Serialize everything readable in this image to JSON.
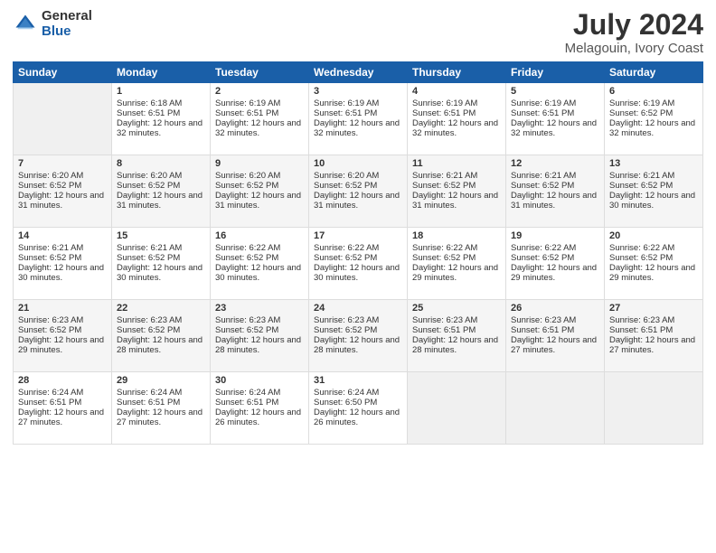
{
  "header": {
    "logo_general": "General",
    "logo_blue": "Blue",
    "month_title": "July 2024",
    "location": "Melagouin, Ivory Coast"
  },
  "days_of_week": [
    "Sunday",
    "Monday",
    "Tuesday",
    "Wednesday",
    "Thursday",
    "Friday",
    "Saturday"
  ],
  "weeks": [
    [
      {
        "day": "",
        "sunrise": "",
        "sunset": "",
        "daylight": ""
      },
      {
        "day": "1",
        "sunrise": "Sunrise: 6:18 AM",
        "sunset": "Sunset: 6:51 PM",
        "daylight": "Daylight: 12 hours and 32 minutes."
      },
      {
        "day": "2",
        "sunrise": "Sunrise: 6:19 AM",
        "sunset": "Sunset: 6:51 PM",
        "daylight": "Daylight: 12 hours and 32 minutes."
      },
      {
        "day": "3",
        "sunrise": "Sunrise: 6:19 AM",
        "sunset": "Sunset: 6:51 PM",
        "daylight": "Daylight: 12 hours and 32 minutes."
      },
      {
        "day": "4",
        "sunrise": "Sunrise: 6:19 AM",
        "sunset": "Sunset: 6:51 PM",
        "daylight": "Daylight: 12 hours and 32 minutes."
      },
      {
        "day": "5",
        "sunrise": "Sunrise: 6:19 AM",
        "sunset": "Sunset: 6:51 PM",
        "daylight": "Daylight: 12 hours and 32 minutes."
      },
      {
        "day": "6",
        "sunrise": "Sunrise: 6:19 AM",
        "sunset": "Sunset: 6:52 PM",
        "daylight": "Daylight: 12 hours and 32 minutes."
      }
    ],
    [
      {
        "day": "7",
        "sunrise": "Sunrise: 6:20 AM",
        "sunset": "Sunset: 6:52 PM",
        "daylight": "Daylight: 12 hours and 31 minutes."
      },
      {
        "day": "8",
        "sunrise": "Sunrise: 6:20 AM",
        "sunset": "Sunset: 6:52 PM",
        "daylight": "Daylight: 12 hours and 31 minutes."
      },
      {
        "day": "9",
        "sunrise": "Sunrise: 6:20 AM",
        "sunset": "Sunset: 6:52 PM",
        "daylight": "Daylight: 12 hours and 31 minutes."
      },
      {
        "day": "10",
        "sunrise": "Sunrise: 6:20 AM",
        "sunset": "Sunset: 6:52 PM",
        "daylight": "Daylight: 12 hours and 31 minutes."
      },
      {
        "day": "11",
        "sunrise": "Sunrise: 6:21 AM",
        "sunset": "Sunset: 6:52 PM",
        "daylight": "Daylight: 12 hours and 31 minutes."
      },
      {
        "day": "12",
        "sunrise": "Sunrise: 6:21 AM",
        "sunset": "Sunset: 6:52 PM",
        "daylight": "Daylight: 12 hours and 31 minutes."
      },
      {
        "day": "13",
        "sunrise": "Sunrise: 6:21 AM",
        "sunset": "Sunset: 6:52 PM",
        "daylight": "Daylight: 12 hours and 30 minutes."
      }
    ],
    [
      {
        "day": "14",
        "sunrise": "Sunrise: 6:21 AM",
        "sunset": "Sunset: 6:52 PM",
        "daylight": "Daylight: 12 hours and 30 minutes."
      },
      {
        "day": "15",
        "sunrise": "Sunrise: 6:21 AM",
        "sunset": "Sunset: 6:52 PM",
        "daylight": "Daylight: 12 hours and 30 minutes."
      },
      {
        "day": "16",
        "sunrise": "Sunrise: 6:22 AM",
        "sunset": "Sunset: 6:52 PM",
        "daylight": "Daylight: 12 hours and 30 minutes."
      },
      {
        "day": "17",
        "sunrise": "Sunrise: 6:22 AM",
        "sunset": "Sunset: 6:52 PM",
        "daylight": "Daylight: 12 hours and 30 minutes."
      },
      {
        "day": "18",
        "sunrise": "Sunrise: 6:22 AM",
        "sunset": "Sunset: 6:52 PM",
        "daylight": "Daylight: 12 hours and 29 minutes."
      },
      {
        "day": "19",
        "sunrise": "Sunrise: 6:22 AM",
        "sunset": "Sunset: 6:52 PM",
        "daylight": "Daylight: 12 hours and 29 minutes."
      },
      {
        "day": "20",
        "sunrise": "Sunrise: 6:22 AM",
        "sunset": "Sunset: 6:52 PM",
        "daylight": "Daylight: 12 hours and 29 minutes."
      }
    ],
    [
      {
        "day": "21",
        "sunrise": "Sunrise: 6:23 AM",
        "sunset": "Sunset: 6:52 PM",
        "daylight": "Daylight: 12 hours and 29 minutes."
      },
      {
        "day": "22",
        "sunrise": "Sunrise: 6:23 AM",
        "sunset": "Sunset: 6:52 PM",
        "daylight": "Daylight: 12 hours and 28 minutes."
      },
      {
        "day": "23",
        "sunrise": "Sunrise: 6:23 AM",
        "sunset": "Sunset: 6:52 PM",
        "daylight": "Daylight: 12 hours and 28 minutes."
      },
      {
        "day": "24",
        "sunrise": "Sunrise: 6:23 AM",
        "sunset": "Sunset: 6:52 PM",
        "daylight": "Daylight: 12 hours and 28 minutes."
      },
      {
        "day": "25",
        "sunrise": "Sunrise: 6:23 AM",
        "sunset": "Sunset: 6:51 PM",
        "daylight": "Daylight: 12 hours and 28 minutes."
      },
      {
        "day": "26",
        "sunrise": "Sunrise: 6:23 AM",
        "sunset": "Sunset: 6:51 PM",
        "daylight": "Daylight: 12 hours and 27 minutes."
      },
      {
        "day": "27",
        "sunrise": "Sunrise: 6:23 AM",
        "sunset": "Sunset: 6:51 PM",
        "daylight": "Daylight: 12 hours and 27 minutes."
      }
    ],
    [
      {
        "day": "28",
        "sunrise": "Sunrise: 6:24 AM",
        "sunset": "Sunset: 6:51 PM",
        "daylight": "Daylight: 12 hours and 27 minutes."
      },
      {
        "day": "29",
        "sunrise": "Sunrise: 6:24 AM",
        "sunset": "Sunset: 6:51 PM",
        "daylight": "Daylight: 12 hours and 27 minutes."
      },
      {
        "day": "30",
        "sunrise": "Sunrise: 6:24 AM",
        "sunset": "Sunset: 6:51 PM",
        "daylight": "Daylight: 12 hours and 26 minutes."
      },
      {
        "day": "31",
        "sunrise": "Sunrise: 6:24 AM",
        "sunset": "Sunset: 6:50 PM",
        "daylight": "Daylight: 12 hours and 26 minutes."
      },
      {
        "day": "",
        "sunrise": "",
        "sunset": "",
        "daylight": ""
      },
      {
        "day": "",
        "sunrise": "",
        "sunset": "",
        "daylight": ""
      },
      {
        "day": "",
        "sunrise": "",
        "sunset": "",
        "daylight": ""
      }
    ]
  ]
}
